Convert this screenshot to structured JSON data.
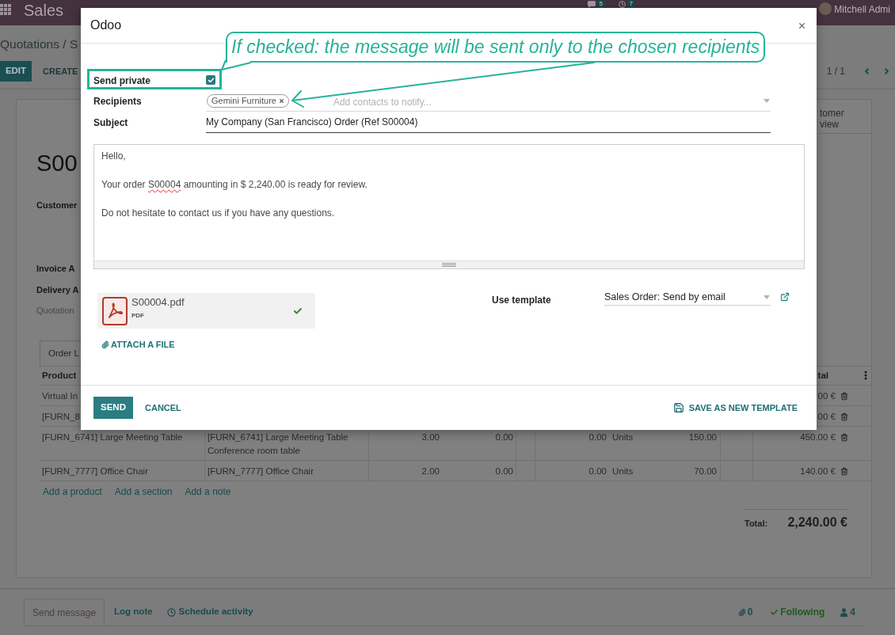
{
  "navbar": {
    "app_name": "Sales",
    "notifications": [
      {
        "kind": "chat",
        "count": "5"
      },
      {
        "kind": "activity",
        "count": "7"
      }
    ],
    "user_name": "Mitchell Admi"
  },
  "control_panel": {
    "breadcrumb": "Quotations / S",
    "buttons": [
      {
        "label": "EDIT",
        "kind": "primary"
      },
      {
        "label": "CREATE",
        "kind": "secondary"
      }
    ],
    "pager": "1 / 1"
  },
  "sheet": {
    "smart_button": {
      "lines": [
        "tomer",
        "view"
      ]
    },
    "title": "S00",
    "field_groups": [
      [
        {
          "label": "Customer",
          "kind": "strong"
        }
      ],
      [
        {
          "label": "Invoice A",
          "kind": "strong"
        },
        {
          "label": "Delivery A",
          "kind": "strong"
        },
        {
          "label": "Quotation",
          "kind": "muted"
        }
      ]
    ],
    "notebook_tabs": [
      {
        "label": "Order L",
        "selected": true
      }
    ],
    "order_lines": {
      "header": {
        "column_1": "Product",
        "column_8": "tal"
      },
      "rows": [
        {
          "column_1": "Virtual In",
          "column_8": "00 €"
        },
        {
          "column_1": "[FURN_8",
          "column_8": "00 €"
        },
        {
          "column_1": "[FURN_6741] Large Meeting Table",
          "column_2": "[FURN_6741] Large Meeting Table\nConference room table",
          "column_3": "3.00",
          "column_4": "0.00",
          "column_5": "0.00",
          "column_6": "Units",
          "column_7": "150.00",
          "column_8": "450.00 €"
        },
        {
          "column_1": "[FURN_7777] Office Chair",
          "column_2": "[FURN_7777] Office Chair",
          "column_3": "2.00",
          "column_4": "0.00",
          "column_5": "0.00",
          "column_6": "Units",
          "column_7": "70.00",
          "column_8": "140.00 €"
        }
      ],
      "actions": [
        "Add a product",
        "Add a section",
        "Add a note"
      ]
    },
    "total": {
      "label": "Total:",
      "amount": "2,240.00 €"
    }
  },
  "chatter": {
    "tabs": [
      {
        "label": "Send message",
        "kind": "message",
        "selected": true
      },
      {
        "label": "Log note",
        "kind": "note",
        "selected": false
      },
      {
        "label": "Schedule activity",
        "kind": "activity",
        "selected": false
      }
    ],
    "attachment_count": "0",
    "follow": {
      "label": "Following",
      "following": true
    },
    "follower_count": "4"
  },
  "dialog": {
    "title": "Odoo",
    "send_private": {
      "label": "Send private",
      "checked": true
    },
    "recipients": {
      "label": "Recipients",
      "tags": [
        {
          "name": "Gemini Furniture"
        }
      ],
      "placeholder": "Add contacts to notify..."
    },
    "subject": {
      "label": "Subject",
      "value": "My Company (San Francisco) Order (Ref S00004)"
    },
    "body": {
      "paragraphs": [
        {
          "segments": [
            {
              "text": "Hello,",
              "misspelled": false
            }
          ]
        },
        {
          "segments": [
            {
              "text": "Your order ",
              "misspelled": false
            },
            {
              "text": "S00004",
              "misspelled": true
            },
            {
              "text": " amounting in $ 2,240.00 is ready for review.",
              "misspelled": false
            }
          ]
        },
        {
          "segments": [
            {
              "text": "Do not hesitate to contact us if you have any questions.",
              "misspelled": false
            }
          ]
        }
      ]
    },
    "attachments": [
      {
        "name": "S00004.pdf",
        "type": "PDF",
        "uploaded": true
      }
    ],
    "attach_label": "ATTACH A FILE",
    "template": {
      "label": "Use template",
      "value": "Sales Order: Send by email"
    },
    "buttons": [
      {
        "label": "SEND",
        "kind": "primary"
      },
      {
        "label": "CANCEL",
        "kind": "link"
      },
      {
        "label": "SAVE AS NEW TEMPLATE",
        "kind": "save"
      }
    ]
  },
  "annotation": {
    "text": "If checked: the message will be sent only to the chosen recipients"
  }
}
